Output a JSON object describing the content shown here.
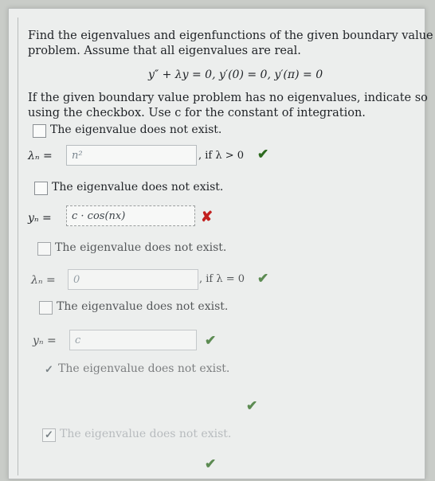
{
  "problem": {
    "line1": "Find the eigenvalues and eigenfunctions of the given boundary value",
    "line2": "problem. Assume that all eigenvalues are real.",
    "equation": "y″ + λy = 0, y′(0) = 0, y′(π) = 0",
    "instr1": "If the given boundary value problem has no eigenvalues, indicate so",
    "instr2": "using the checkbox. Use c for the constant of integration."
  },
  "checkbox_label": "The eigenvalue does not exist.",
  "blocks": [
    {
      "checkbox_checked": false,
      "field_label": "λₙ =",
      "field_value": "n²",
      "condition": ", if λ > 0",
      "status": "correct"
    },
    {
      "checkbox_checked": false,
      "field_label": "yₙ =",
      "field_value": "c · cos(nx)",
      "status": "incorrect"
    },
    {
      "checkbox_checked": false,
      "field_label": "λₙ =",
      "field_value": "0",
      "condition": ", if λ = 0",
      "status": "correct"
    },
    {
      "checkbox_checked": false,
      "field_label": "yₙ =",
      "field_value": "c",
      "status": "correct"
    },
    {
      "checkbox_checked": true,
      "status": "correct"
    },
    {
      "checkbox_checked": true,
      "status": "correct"
    }
  ],
  "icons": {
    "correct": "✔",
    "incorrect": "✘",
    "checked": "✓"
  },
  "colors": {
    "correct": "#2d6a1f",
    "incorrect": "#c2201f"
  }
}
